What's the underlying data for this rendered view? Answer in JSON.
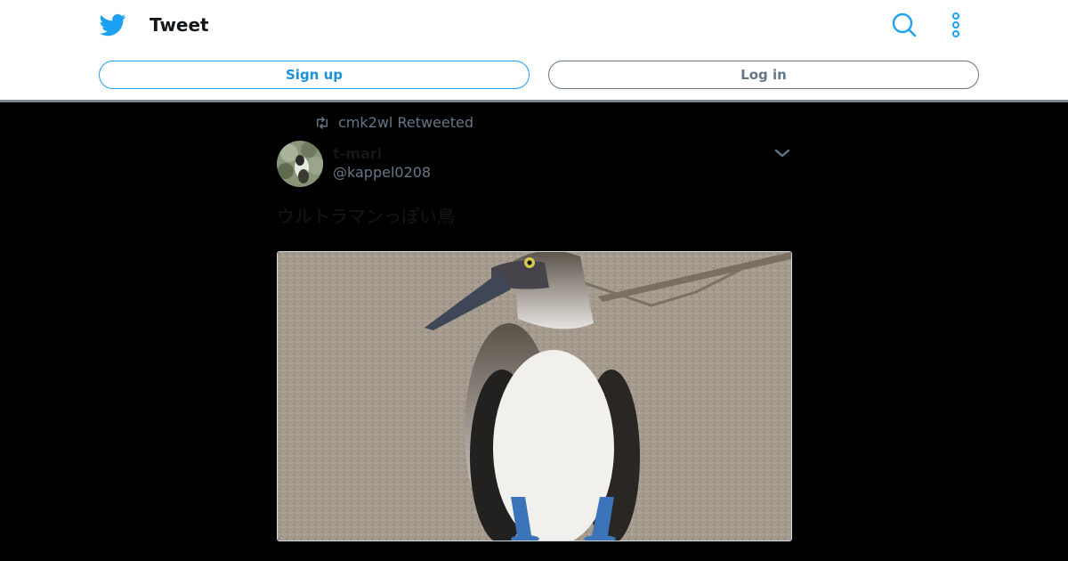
{
  "header": {
    "title": "Tweet",
    "logo_icon": "twitter-bird-icon",
    "search_icon": "search-icon",
    "more_icon": "more-vertical-icon",
    "brand_color": "#1da1f2"
  },
  "auth": {
    "signup_label": "Sign up",
    "login_label": "Log in"
  },
  "tweet": {
    "retweet_label": "cmk2wl Retweeted",
    "retweet_icon": "retweet-icon",
    "author_name": "t-mari",
    "author_handle": "@kappel0208",
    "caret_icon": "chevron-down-icon",
    "text": "ウルトラマンっぽい鳥",
    "media_alt": "blue-footed booby photo"
  }
}
